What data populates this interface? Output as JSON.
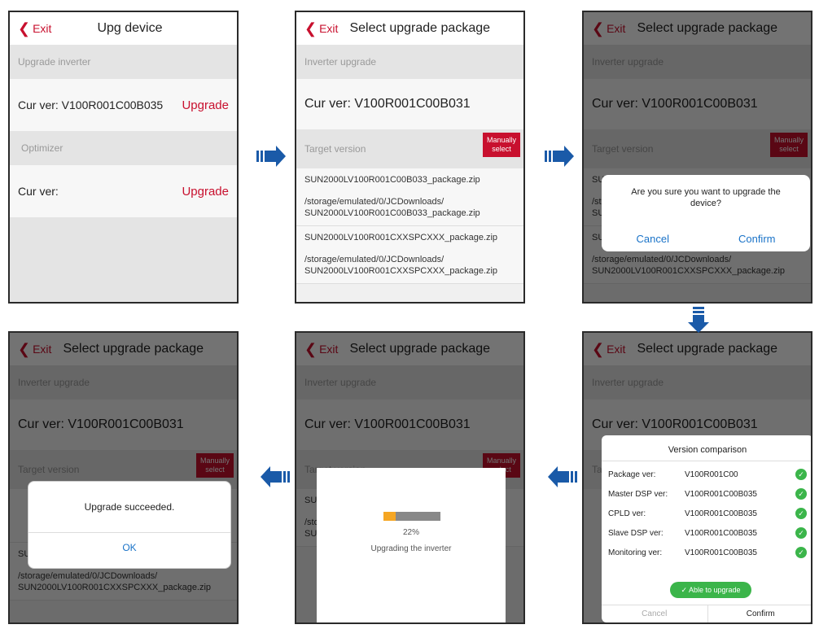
{
  "s1": {
    "exit": "Exit",
    "title": "Upg device",
    "section_inverter": "Upgrade inverter",
    "cur_ver_inv": "Cur ver: V100R001C00B035",
    "upgrade1": "Upgrade",
    "section_optimizer": "Optimizer",
    "cur_ver_opt": "Cur ver:",
    "upgrade2": "Upgrade"
  },
  "common": {
    "exit": "Exit",
    "title": "Select upgrade package",
    "inverter_upgrade": "Inverter upgrade",
    "cur_ver": "Cur ver:  V100R001C00B031",
    "target_version": "Target version",
    "manual_select": "Manually select",
    "pkg1_name": "SUN2000LV100R001C00B033_package.zip",
    "pkg1_path": "/storage/emulated/0/JCDownloads/ SUN2000LV100R001C00B033_package.zip",
    "pkg2_name": "SUN2000LV100R001CXXSPCXXX_package.zip",
    "pkg2_path": "/storage/emulated/0/JCDownloads/ SUN2000LV100R001CXXSPCXXX_package.zip"
  },
  "s3": {
    "msg": "Are you sure you want to upgrade the device?",
    "cancel": "Cancel",
    "confirm": "Confirm"
  },
  "s4": {
    "msg": "Upgrade succeeded.",
    "ok": "OK"
  },
  "s5": {
    "progress": 0.22,
    "percent": "22%",
    "status": "Upgrading the inverter"
  },
  "s6": {
    "title": "Version comparison",
    "rows": [
      {
        "label": "Package ver:",
        "value": "V100R001C00"
      },
      {
        "label": "Master DSP ver:",
        "value": "V100R001C00B035"
      },
      {
        "label": "CPLD ver:",
        "value": "V100R001C00B035"
      },
      {
        "label": "Slave DSP ver:",
        "value": "V100R001C00B035"
      },
      {
        "label": "Monitoring ver:",
        "value": "V100R001C00B035"
      }
    ],
    "able": "Able to upgrade",
    "cancel": "Cancel",
    "confirm": "Confirm"
  },
  "colors": {
    "accent": "#c8102e",
    "arrow": "#1a5aa8",
    "success": "#3bb54a",
    "progress": "#f5a623"
  },
  "icons": {
    "flow_arrow": "arrow-icon",
    "check": "check-icon"
  }
}
